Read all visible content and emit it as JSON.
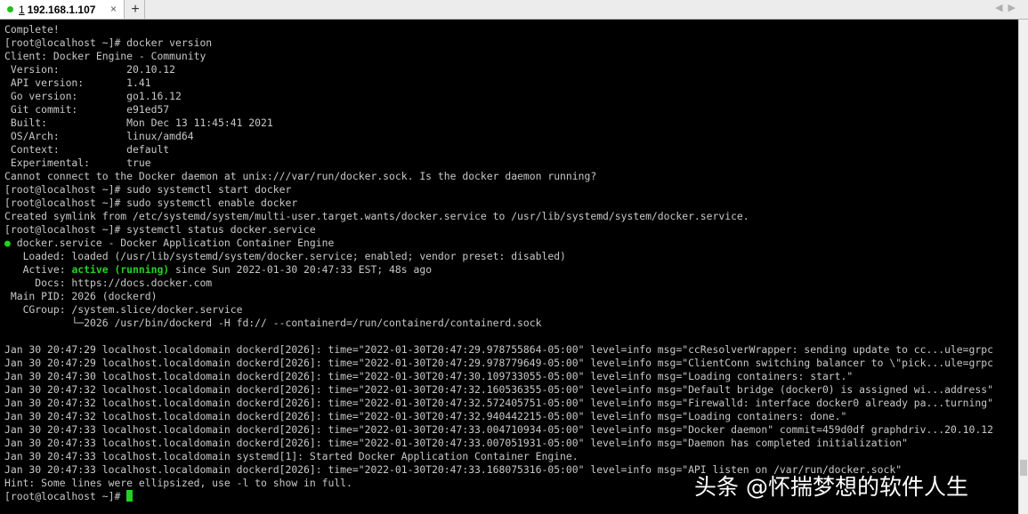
{
  "tab": {
    "number": "1",
    "title": "192.168.1.107",
    "close": "×"
  },
  "new_tab": "+",
  "lines": [
    "Complete!",
    "[root@localhost ~]# docker version",
    "Client: Docker Engine - Community",
    " Version:           20.10.12",
    " API version:       1.41",
    " Go version:        go1.16.12",
    " Git commit:        e91ed57",
    " Built:             Mon Dec 13 11:45:41 2021",
    " OS/Arch:           linux/amd64",
    " Context:           default",
    " Experimental:      true",
    "Cannot connect to the Docker daemon at unix:///var/run/docker.sock. Is the docker daemon running?",
    "[root@localhost ~]# sudo systemctl start docker",
    "[root@localhost ~]# sudo systemctl enable docker",
    "Created symlink from /etc/systemd/system/multi-user.target.wants/docker.service to /usr/lib/systemd/system/docker.service.",
    "[root@localhost ~]# systemctl status docker.service"
  ],
  "status": {
    "bullet": "●",
    "service_line": " docker.service - Docker Application Container Engine",
    "loaded": "   Loaded: loaded (/usr/lib/systemd/system/docker.service; enabled; vendor preset: disabled)",
    "active_label": "   Active: ",
    "active_state": "active (running)",
    "active_rest": " since Sun 2022-01-30 20:47:33 EST; 48s ago",
    "docs": "     Docs: https://docs.docker.com",
    "main_pid": " Main PID: 2026 (dockerd)",
    "cgroup": "   CGroup: /system.slice/docker.service",
    "cgroup_child": "           └─2026 /usr/bin/dockerd -H fd:// --containerd=/run/containerd/containerd.sock"
  },
  "logs": [
    "Jan 30 20:47:29 localhost.localdomain dockerd[2026]: time=\"2022-01-30T20:47:29.978755864-05:00\" level=info msg=\"ccResolverWrapper: sending update to cc...ule=grpc",
    "Jan 30 20:47:29 localhost.localdomain dockerd[2026]: time=\"2022-01-30T20:47:29.978779649-05:00\" level=info msg=\"ClientConn switching balancer to \\\"pick...ule=grpc",
    "Jan 30 20:47:30 localhost.localdomain dockerd[2026]: time=\"2022-01-30T20:47:30.109733055-05:00\" level=info msg=\"Loading containers: start.\"",
    "Jan 30 20:47:32 localhost.localdomain dockerd[2026]: time=\"2022-01-30T20:47:32.160536355-05:00\" level=info msg=\"Default bridge (docker0) is assigned wi...address\"",
    "Jan 30 20:47:32 localhost.localdomain dockerd[2026]: time=\"2022-01-30T20:47:32.572405751-05:00\" level=info msg=\"Firewalld: interface docker0 already pa...turning\"",
    "Jan 30 20:47:32 localhost.localdomain dockerd[2026]: time=\"2022-01-30T20:47:32.940442215-05:00\" level=info msg=\"Loading containers: done.\"",
    "Jan 30 20:47:33 localhost.localdomain dockerd[2026]: time=\"2022-01-30T20:47:33.004710934-05:00\" level=info msg=\"Docker daemon\" commit=459d0df graphdriv...20.10.12",
    "Jan 30 20:47:33 localhost.localdomain dockerd[2026]: time=\"2022-01-30T20:47:33.007051931-05:00\" level=info msg=\"Daemon has completed initialization\"",
    "Jan 30 20:47:33 localhost.localdomain systemd[1]: Started Docker Application Container Engine.",
    "Jan 30 20:47:33 localhost.localdomain dockerd[2026]: time=\"2022-01-30T20:47:33.168075316-05:00\" level=info msg=\"API listen on /var/run/docker.sock\""
  ],
  "hint": "Hint: Some lines were ellipsized, use -l to show in full.",
  "prompt": "[root@localhost ~]# ",
  "watermark": "头条 @怀揣梦想的软件人生",
  "colors": {
    "tab_dot": "#1ec11e",
    "active_state": "#21d421",
    "cursor": "#1ed41e",
    "terminal_bg": "#000000",
    "text": "#c8c8c8"
  }
}
